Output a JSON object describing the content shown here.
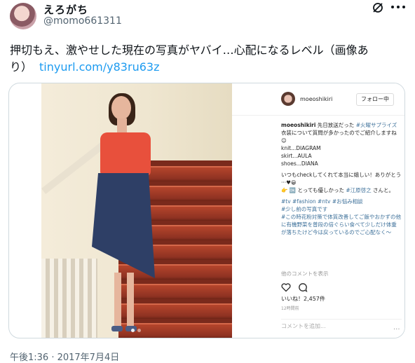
{
  "post": {
    "display_name": "えろがち",
    "handle": "@momo661311",
    "text_line1": "押切もえ、激やせした現在の写真がヤバイ…心配になるレベル（画像あ",
    "text_line2": "り）",
    "link": "tinyurl.com/y83ru63z",
    "timestamp": "午後1:36 · 2017年7月4日"
  },
  "embed": {
    "username": "moeoshikiri",
    "follow_label": "フォロー中",
    "caption_line1_user": "moeoshikiri",
    "caption_line1_text": " 先日放送だった ",
    "caption_line1_tag": "#火曜サプライズ",
    "caption_line2": "衣装について質問が多かったのでご紹介しますね☺",
    "caption_items": [
      "knit...DIAGRAM",
      "skirt...AULA",
      "shoes...DIANA"
    ],
    "caption_para2": "いつもcheckしてくれて本当に嬉しい！ありがとう···♥😀",
    "caption_para3_prefix": "👉 🆗 とっても優しかった ",
    "caption_para3_tag": "#江原啓之",
    "caption_para3_suffix": " さんと。",
    "caption_tags": "#tv #fashion #ntv #お悩み相談",
    "caption_para4": "#少し前の写真です",
    "caption_para5": "#この時花粉対策で体質改善してご飯やおかずの他に有機野菜を普段の倍ぐらい食べて少しだけ体重が落ちたけど今は戻っているのでご心配なく〜",
    "more_comments": "他のコメントを表示",
    "likes": "いいね！2,457件",
    "time_small": "12時間前",
    "comment_placeholder": "コメントを追加...",
    "more_dots": "···"
  }
}
